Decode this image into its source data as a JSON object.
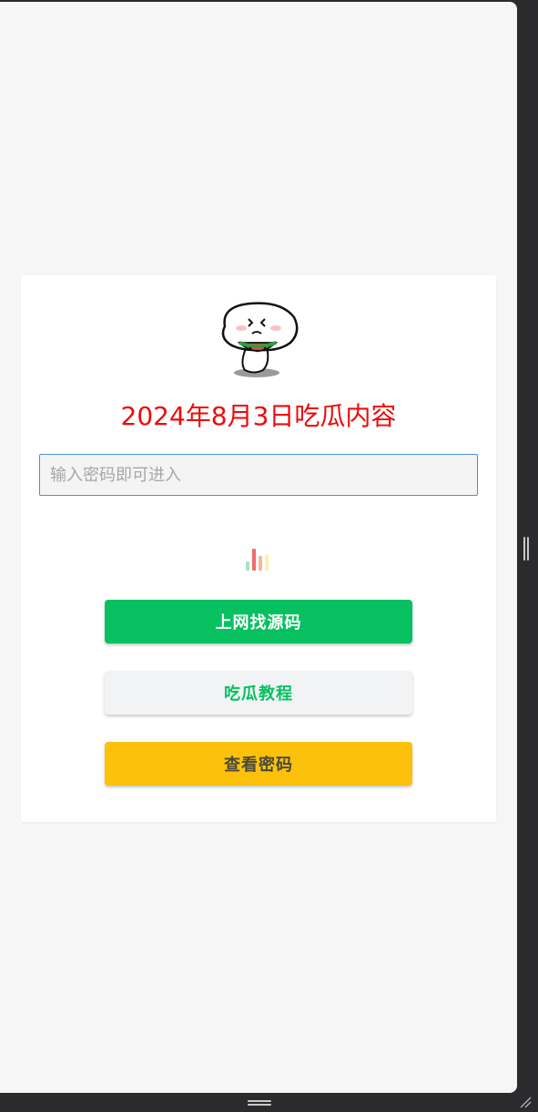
{
  "page": {
    "title": "2024年8月3日吃瓜内容",
    "mascot_icon": "mascot-eating-watermelon-icon"
  },
  "password": {
    "placeholder": "输入密码即可进入",
    "value": ""
  },
  "loader": {
    "icon": "loading-bars-icon",
    "colors": [
      "#a8e6b8",
      "#f26b6b",
      "#f7b89a",
      "#faf3b0"
    ]
  },
  "buttons": {
    "source_label": "上网找源码",
    "tutorial_label": "吃瓜教程",
    "view_password_label": "查看密码"
  },
  "colors": {
    "title": "#ee0a0a",
    "primary_green": "#07c160",
    "secondary_bg": "#f2f3f5",
    "warning_yellow": "#fcc10a",
    "input_border": "#4a90d9"
  }
}
